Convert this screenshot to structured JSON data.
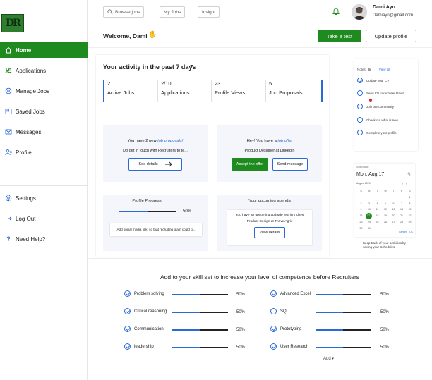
{
  "sidebar": {
    "logo_text": "DR",
    "items": [
      {
        "label": "Home",
        "icon": "home-icon"
      },
      {
        "label": "Applications",
        "icon": "applications-icon"
      },
      {
        "label": "Manage Jobs",
        "icon": "manage-jobs-icon"
      },
      {
        "label": "Saved Jobs",
        "icon": "saved-jobs-icon"
      },
      {
        "label": "Messages",
        "icon": "messages-icon"
      },
      {
        "label": "Profile",
        "icon": "profile-icon"
      },
      {
        "label": "Settings",
        "icon": "settings-icon"
      },
      {
        "label": "Log Out",
        "icon": "logout-icon"
      },
      {
        "label": "Need Help?",
        "icon": "help-icon"
      }
    ]
  },
  "topbar": {
    "browse": "Browse jobs",
    "myjobs": "My Jobs",
    "insight": "Insight",
    "user_name": "Dami Ayo",
    "user_email": "Damiayo@gmail.com"
  },
  "welcome": {
    "text": "Welcome, Dami",
    "take_test": "Take a test",
    "update_profile": "Update profile"
  },
  "activity": {
    "title": "Your activity in the past 7 days",
    "stats": [
      {
        "value": "2",
        "label": "Active Jobs"
      },
      {
        "value": "2/10",
        "label": "Applications"
      },
      {
        "value": "23",
        "label": "Profile Views"
      },
      {
        "value": "5",
        "label": "Job Proposals"
      }
    ]
  },
  "proposals": {
    "lead": "You have 2 new ",
    "link": "job proposals!",
    "sub": "Do get in touch with Recruiters to te...",
    "button": "See details"
  },
  "offer": {
    "lead": "Hey! You have a ",
    "link": "job offer",
    "sub": "Product Designer at LinkedIn",
    "accept": "Accept the offer",
    "message": "Send message"
  },
  "progress": {
    "title": "Profile Progress",
    "percent_text": "50%",
    "value": 0.5,
    "tip": "Add social media link, so that recruiting team could g..."
  },
  "agenda": {
    "title": "Your upcoming agenda",
    "line1": "You have an upcoming aptitude test in 7 days",
    "line2": "Product Design at Thrive Agric",
    "button": "View details"
  },
  "todo": {
    "header": "Notes",
    "view_all": "View all",
    "items": [
      {
        "label": "Update Your CV",
        "done": true
      },
      {
        "label": "Send CV to recruiter David",
        "done": false
      },
      {
        "label": "Join our community",
        "done": false
      },
      {
        "label": "Check out what is new",
        "done": false
      },
      {
        "label": "Complete your profile",
        "done": false
      }
    ]
  },
  "calendar": {
    "label": "Select date",
    "date": "Mon, Aug 17",
    "month": "August 2020",
    "weekdays": [
      "S",
      "M",
      "T",
      "W",
      "T",
      "F",
      "S"
    ],
    "days": [
      "",
      "",
      "",
      "",
      "",
      "",
      "1",
      "2",
      "3",
      "4",
      "5",
      "6",
      "7",
      "8",
      "9",
      "10",
      "11",
      "12",
      "13",
      "14",
      "15",
      "16",
      "17",
      "18",
      "19",
      "20",
      "21",
      "22",
      "23",
      "24",
      "25",
      "26",
      "27",
      "28",
      "29",
      "30",
      "31"
    ],
    "selected": "17",
    "cancel": "Cancel",
    "ok": "OK",
    "note": "Keep track of your activities by saving your Schedules"
  },
  "skills": {
    "title": "Add to your skill set to increase your level of competence before Recruiters",
    "left": [
      {
        "name": "Problem solving",
        "pct": "50%",
        "value": 0.5,
        "done": true
      },
      {
        "name": "Critical reasoning",
        "pct": "50%",
        "value": 0.5,
        "done": true
      },
      {
        "name": "Communication",
        "pct": "50%",
        "value": 0.5,
        "done": true
      },
      {
        "name": "leadership",
        "pct": "50%",
        "value": 0.5,
        "done": true
      }
    ],
    "right": [
      {
        "name": "Advanced Excel",
        "pct": "50%",
        "value": 0.5,
        "done": true
      },
      {
        "name": "SQL",
        "pct": "50%",
        "value": 0.5,
        "done": false
      },
      {
        "name": "Prototyping",
        "pct": "50%",
        "value": 0.5,
        "done": true
      },
      {
        "name": "User Research",
        "pct": "50%",
        "value": 0.5,
        "done": true
      }
    ],
    "add": "Add"
  },
  "colors": {
    "accent_green": "#1f8a1f",
    "accent_blue": "#2a6ad6"
  }
}
